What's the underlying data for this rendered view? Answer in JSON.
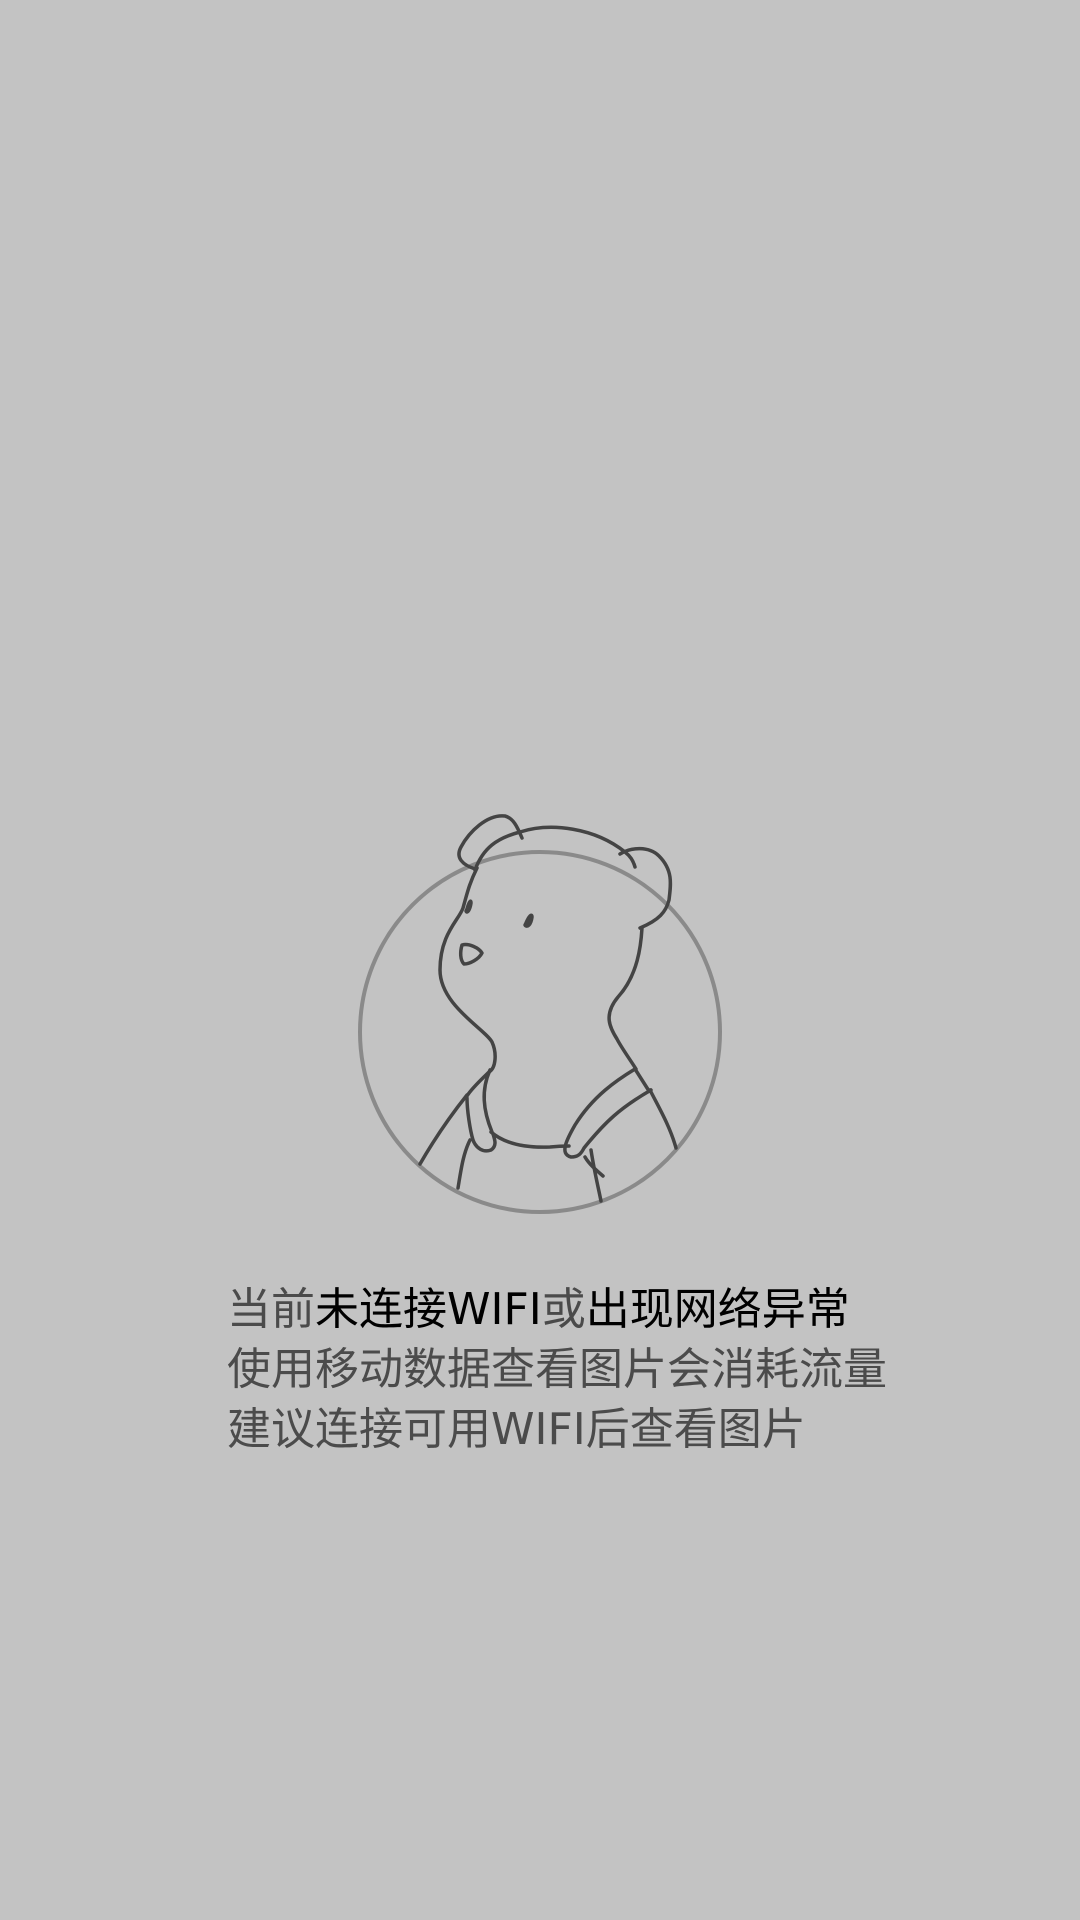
{
  "screen": {
    "background_color": "#c3c3c3",
    "illustration": "bear-character-icon"
  },
  "message": {
    "line1": {
      "part1": "当前",
      "part2": "未连接WIFI",
      "part3": "或",
      "part4": "出现网络异常"
    },
    "line2": "使用移动数据查看图片会消耗流量",
    "line3": "建议连接可用WIFI后查看图片"
  },
  "colors": {
    "muted_text": "#4b4b4b",
    "emphasis_text": "#000000",
    "circle_stroke": "#8a8a8a",
    "line_art": "#444444"
  }
}
